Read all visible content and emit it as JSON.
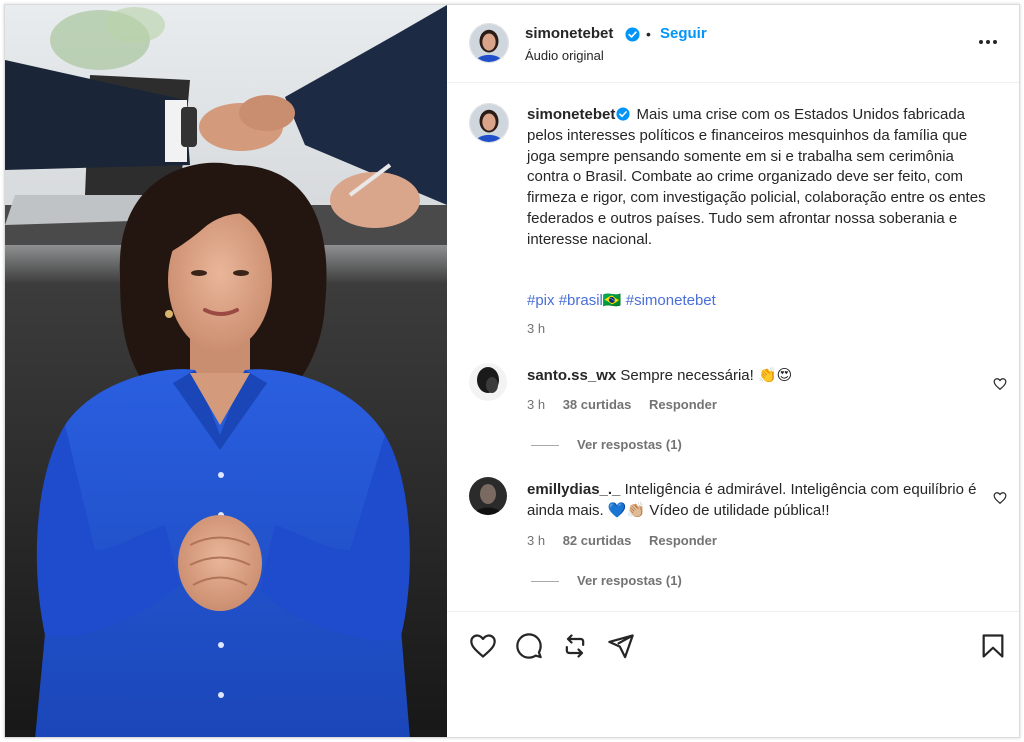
{
  "post": {
    "username": "simonetebet",
    "dot": "•",
    "follow_label": "Seguir",
    "audio_label": "Áudio original",
    "more_icon": "more-options-icon"
  },
  "caption": {
    "username": "simonetebet",
    "text": "Mais uma crise com os Estados Unidos fabricada pelos interesses políticos e financeiros mesquinhos da família que joga sempre pensando somente em si e trabalha sem cerimônia contra o Brasil. Combate ao crime organizado deve ser feito, com firmeza e rigor, com investigação policial, colaboração entre os entes federados e outros países. Tudo sem afrontar nossa soberania e interesse nacional.",
    "hashtags": [
      "#pix",
      "#brasil🇧🇷",
      "#simonetebet"
    ],
    "time": "3 h"
  },
  "comments": [
    {
      "username": "santo.ss_wx",
      "text": "Sempre necessária! 👏😍",
      "time": "3 h",
      "likes": "38 curtidas",
      "reply_label": "Responder",
      "view_replies": "Ver respostas (1)"
    },
    {
      "username": "emillydias_._",
      "text": "Inteligência é admirável. Inteligência com equilíbrio é ainda mais. 💙👏🏼 Vídeo de utilidade pública!!",
      "time": "3 h",
      "likes": "82 curtidas",
      "reply_label": "Responder",
      "view_replies": "Ver respostas (1)"
    }
  ],
  "colors": {
    "follow": "#0095f6",
    "verified": "#0095f6",
    "hashtag": "#4a6fd6",
    "secondary_text": "#737373",
    "blouse": "#1f4fc9"
  },
  "icons": [
    "heart-icon",
    "comment-icon",
    "repost-icon",
    "share-icon",
    "bookmark-icon",
    "verified-badge-icon"
  ]
}
